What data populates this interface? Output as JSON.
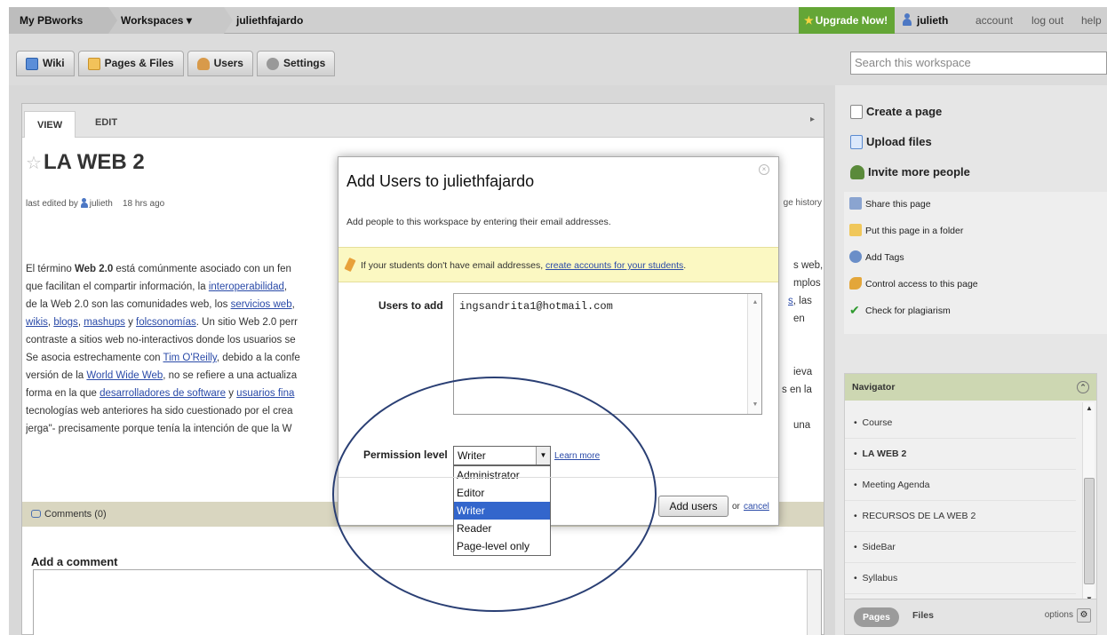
{
  "topbar": {
    "my_pbworks": "My PBworks",
    "workspaces": "Workspaces ▾",
    "workspace_name": "juliethfajardo",
    "upgrade": "Upgrade Now!",
    "username": "julieth",
    "account": "account",
    "logout": "log out",
    "help": "help"
  },
  "nav_tabs": [
    "Wiki",
    "Pages & Files",
    "Users",
    "Settings"
  ],
  "search": {
    "placeholder": "Search this workspace"
  },
  "content": {
    "tab_view": "VIEW",
    "tab_edit": "EDIT",
    "title": "LA WEB 2",
    "last_edited_prefix": "last edited by",
    "last_edited_user": "julieth",
    "last_edited_time": "18 hrs ago",
    "page_history": "ge history",
    "body": {
      "l1a": "El término ",
      "l1b": "Web 2.0",
      "l1c": " está comúnmente asociado con un fen",
      "l2a": "que facilitan el compartir información, la ",
      "l2b": "interoperabilidad",
      "l2c": ",",
      "l3a": "de la Web 2.0 son las comunidades web, los ",
      "l3b": "servicios web",
      "l3c": ",",
      "l4a": "wikis",
      "l4b": ", ",
      "l4c": "blogs",
      "l4d": ", ",
      "l4e": "mashups",
      "l4f": " y ",
      "l4g": "folcsonomías",
      "l4h": ". Un sitio Web 2.0 perr",
      "l5": "contraste a sitios web no-interactivos donde los usuarios se",
      "l6a": "Se asocia estrechamente con ",
      "l6b": "Tim O'Reilly",
      "l6c": ", debido a la confe",
      "l7a": "versión de la ",
      "l7b": "World Wide Web",
      "l7c": ", no se refiere a una actualiza",
      "l8a": "forma en la que ",
      "l8b": "desarrolladores de software",
      "l8c": " y ",
      "l8d": "usuarios fina",
      "l9": "tecnologías web anteriores ha sido cuestionado por el crea",
      "l10": "jerga\"- precisamente porque tenía la intención de que la W",
      "r1": "s web,",
      "r2": "mplos",
      "r3a": "s",
      "r3b": ", las",
      "r4": "en",
      "r6": "ieva",
      "r7": "s en la",
      "r9": "una"
    },
    "comments": "Comments (0)",
    "add_comment": "Add a comment"
  },
  "sidebar": {
    "create_page": "Create a page",
    "upload_files": "Upload files",
    "invite": "Invite more people",
    "share": "Share this page",
    "folder": "Put this page in a folder",
    "tags": "Add Tags",
    "access": "Control access to this page",
    "plagiarism": "Check for plagiarism"
  },
  "navigator": {
    "title": "Navigator",
    "items": [
      "Course",
      "LA WEB 2",
      "Meeting Agenda",
      "RECURSOS DE LA WEB 2",
      "SideBar",
      "Syllabus"
    ],
    "pages_tab": "Pages",
    "files_tab": "Files",
    "options": "options"
  },
  "modal": {
    "title": "Add Users to juliethfajardo",
    "description": "Add people to this workspace by entering their email addresses.",
    "note_prefix": "If your students don't have email addresses, ",
    "note_link": "create accounts for your students",
    "note_suffix": ".",
    "users_label": "Users to add",
    "users_value": "ingsandrita1@hotmail.com",
    "permission_label": "Permission level",
    "permission_value": "Writer",
    "permission_options": [
      "Administrator",
      "Editor",
      "Writer",
      "Reader",
      "Page-level only"
    ],
    "learn_more": "Learn more",
    "add_button": "Add users",
    "or": "or",
    "cancel": "cancel"
  }
}
